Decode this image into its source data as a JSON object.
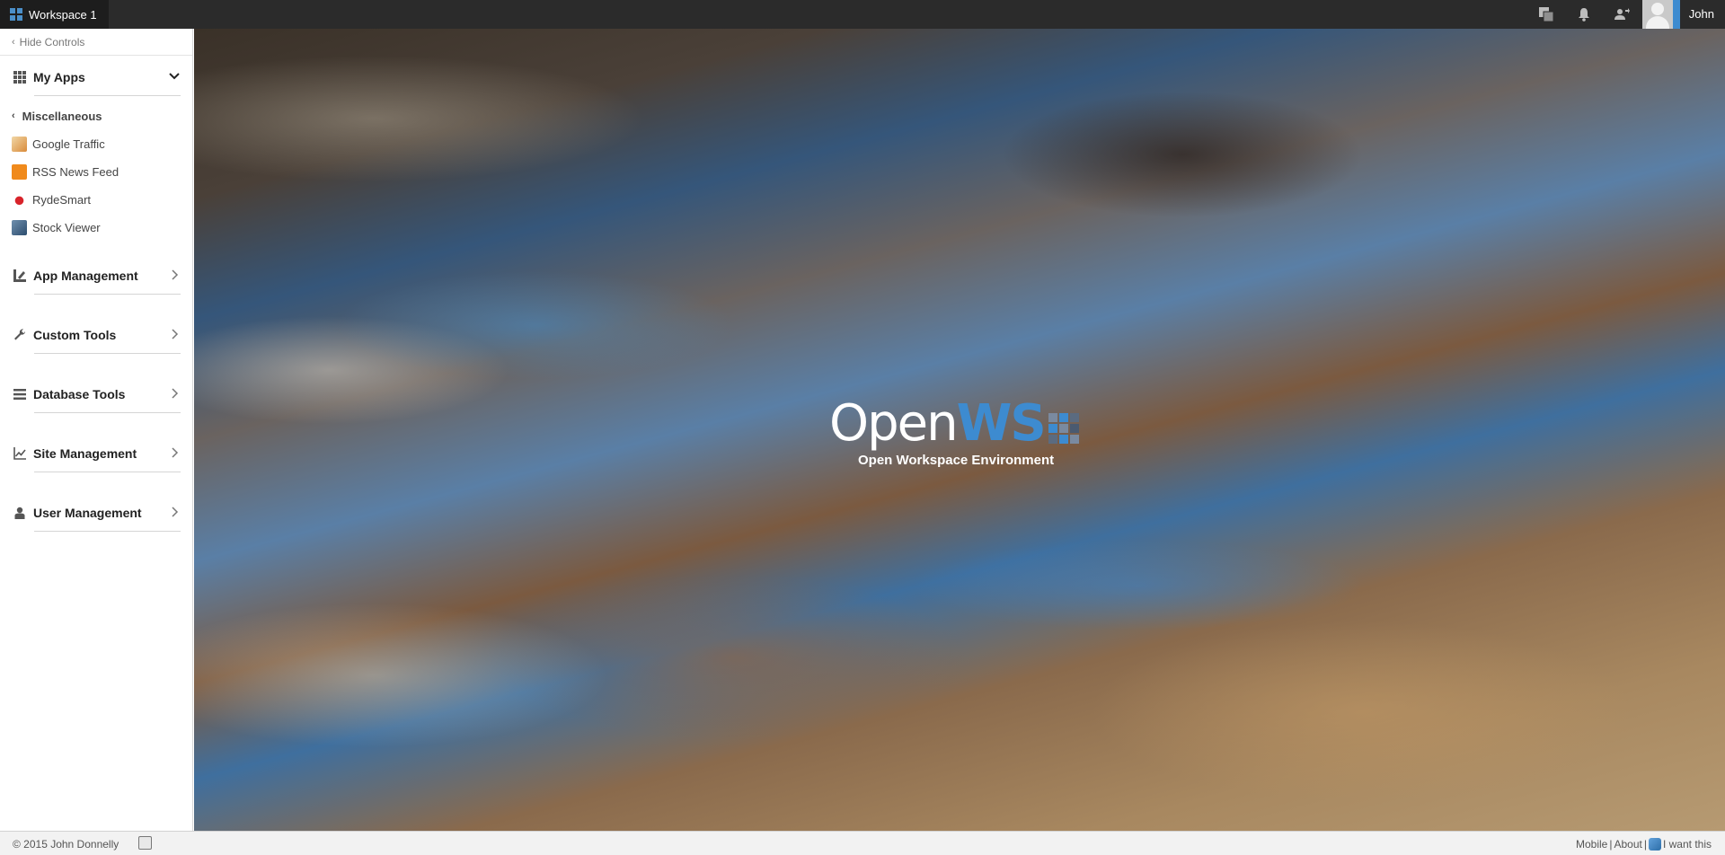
{
  "topbar": {
    "workspace_label": "Workspace 1",
    "user_name": "John",
    "accent_color": "#3d8bd0",
    "icons": [
      "workspace-switch-icon",
      "bell-icon",
      "user-accounts-icon"
    ]
  },
  "sidebar": {
    "hide_controls": "Hide Controls",
    "my_apps": {
      "title": "My Apps",
      "category": "Miscellaneous",
      "apps": [
        {
          "label": "Google Traffic",
          "icon": "traffic-icon"
        },
        {
          "label": "RSS News Feed",
          "icon": "rss-icon"
        },
        {
          "label": "RydeSmart",
          "icon": "rydesmart-icon"
        },
        {
          "label": "Stock Viewer",
          "icon": "stock-icon"
        }
      ]
    },
    "sections": [
      {
        "title": "App Management",
        "icon": "app-management-icon"
      },
      {
        "title": "Custom Tools",
        "icon": "wrench-icon"
      },
      {
        "title": "Database Tools",
        "icon": "list-icon"
      },
      {
        "title": "Site Management",
        "icon": "chart-line-icon"
      },
      {
        "title": "User Management",
        "icon": "user-management-icon"
      }
    ]
  },
  "main": {
    "logo": {
      "word_open": "Open",
      "word_ws": "WS",
      "subtitle": "Open Workspace Environment"
    }
  },
  "footer": {
    "copyright": "© 2015 John Donnelly",
    "links": [
      "Mobile",
      "About",
      "I want this"
    ],
    "separator": "|"
  }
}
